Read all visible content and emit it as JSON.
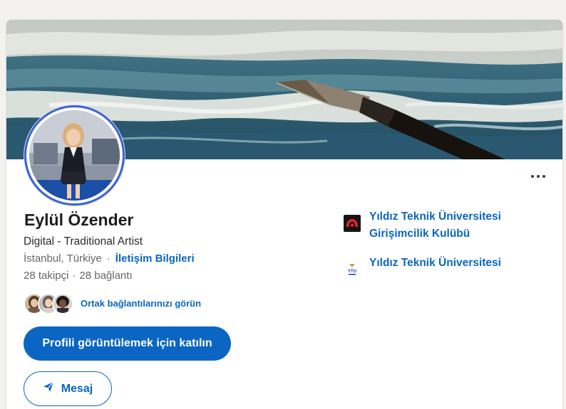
{
  "profile": {
    "name": "Eylül Özender",
    "headline": "Digital - Traditional Artist",
    "location": "İstanbul, Türkiye",
    "contact_link": "İletişim Bilgileri",
    "followers": "28 takipçi",
    "connections": "28 bağlantı"
  },
  "mutual": {
    "label": "Ortak bağlantılarınızı görün"
  },
  "actions": {
    "join_label": "Profili görüntülemek için katılın",
    "message_label": "Mesaj"
  },
  "organizations": [
    {
      "name_line1": "Yıldız Teknik Üniversitesi",
      "name_line2": "Girişimcilik Kulübü",
      "logo": "entrepreneurship-club-logo"
    },
    {
      "name": "Yıldız Teknik Üniversitesi",
      "logo": "ytu-logo",
      "logo_text": "YTU"
    }
  ],
  "icons": {
    "more": "more-horizontal-icon",
    "send": "paper-plane-icon"
  },
  "colors": {
    "accent": "#0a66c2",
    "avatar_ring": "#3b63d6",
    "background": "#f4f2ee"
  }
}
